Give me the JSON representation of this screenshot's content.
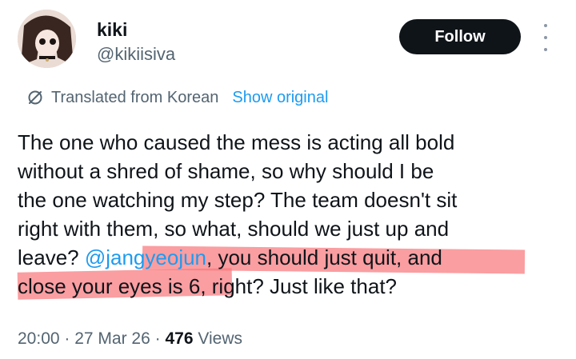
{
  "user": {
    "display_name": "kiki",
    "handle": "@kikiisiva",
    "follow_label": "Follow"
  },
  "translation": {
    "label": "Translated from Korean",
    "show_original": "Show original"
  },
  "tweet": {
    "line1": "The one who caused the mess is acting all bold",
    "line2": "without a shred of shame, so why should I be",
    "line3": "the one watching my step? The team doesn't sit",
    "line4": "right with them, so what, should we just up and",
    "line5_pre": "leave? ",
    "mention": "@jangyeojun",
    "line5_post": ", you should just quit, and",
    "line6": "close your eyes is 6, right? Just like that?"
  },
  "meta": {
    "time": "20:00",
    "sep1": " · ",
    "date": "27 Mar 26",
    "sep2": " · ",
    "views_count": "476",
    "views_label": " Views"
  },
  "colors": {
    "link": "#1d9bf0",
    "secondary": "#536471",
    "highlight": "#f8787d"
  },
  "icons": {
    "translate": "translate-icon",
    "more": "more-icon"
  }
}
